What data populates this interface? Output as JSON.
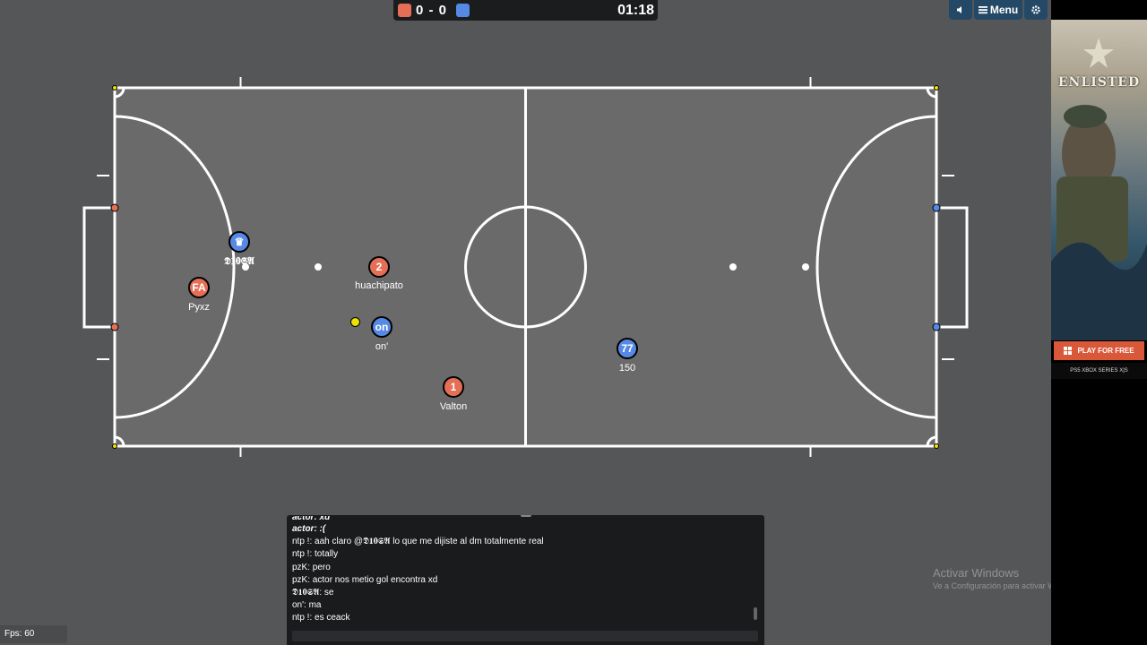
{
  "scoreboard": {
    "score": "0 - 0",
    "timer": "01:18",
    "red_color": "#e56e56",
    "blue_color": "#5689e5"
  },
  "controls": {
    "menu_label": "Menu",
    "sound_icon": "speaker-icon",
    "menu_icon": "hamburger-icon",
    "settings_icon": "gear-icon"
  },
  "players": [
    {
      "avatar": "FA",
      "name": "Pyxz",
      "team": "red"
    },
    {
      "avatar": "2",
      "name": "huachipato",
      "team": "red"
    },
    {
      "avatar": "1",
      "name": "Valton",
      "team": "red"
    },
    {
      "avatar": "♛",
      "name": "𝕯𝟏𝟎𝕾𝕬",
      "team": "blue"
    },
    {
      "avatar": "on",
      "name": "on'",
      "team": "blue"
    },
    {
      "avatar": "77",
      "name": "150",
      "team": "blue"
    }
  ],
  "chat": {
    "lines": [
      "actor: xd",
      "actor: :(",
      "ntp !: aah claro @𝕯𝟏𝟎𝕾𝕬 lo que me dijiste al dm totalmente real",
      "ntp !: totally",
      "pzK: pero",
      "pzK: actor nos metio gol encontra xd",
      "𝕯𝟏𝟎𝕾𝕬: se",
      "on': ma",
      "ntp !: es ceack"
    ],
    "input_value": ""
  },
  "fps": "Fps: 60",
  "windows_watermark": {
    "line1": "Activar Windows",
    "line2": "Ve a Configuración para activar Windows."
  },
  "ad": {
    "brand": "ENLISTED",
    "cta": "PLAY FOR FREE",
    "platforms": "PS5  XBOX SERIES X|S"
  }
}
